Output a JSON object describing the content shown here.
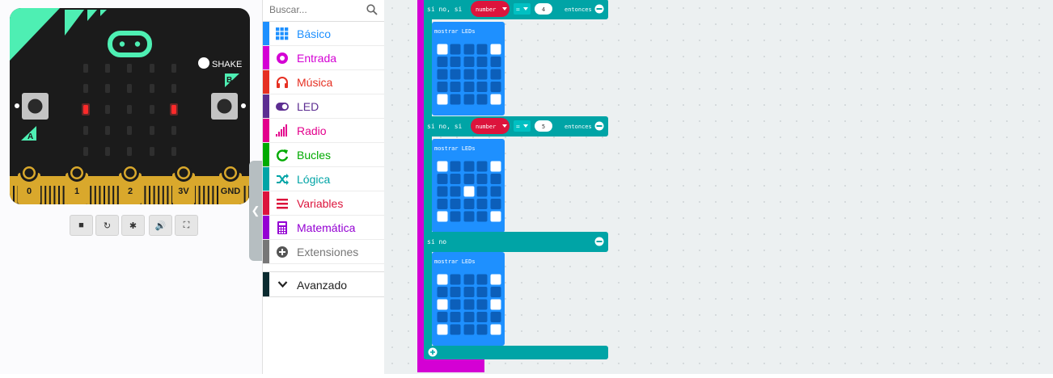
{
  "simulator": {
    "shake_label": "SHAKE",
    "button_a": "A",
    "button_b": "B",
    "pins": [
      "0",
      "1",
      "2",
      "3V",
      "GND"
    ],
    "controls": [
      {
        "name": "stop-button",
        "icon": "stop-icon"
      },
      {
        "name": "restart-button",
        "icon": "restart-icon"
      },
      {
        "name": "debug-button",
        "icon": "bug-icon"
      },
      {
        "name": "mute-button",
        "icon": "speaker-icon"
      },
      {
        "name": "fullscreen-button",
        "icon": "fullscreen-icon"
      }
    ],
    "led_matrix_on": [
      [
        0,
        0,
        0,
        0,
        0
      ],
      [
        0,
        0,
        0,
        0,
        0
      ],
      [
        1,
        0,
        0,
        0,
        1
      ],
      [
        0,
        0,
        0,
        0,
        0
      ],
      [
        0,
        0,
        0,
        0,
        0
      ]
    ]
  },
  "toolbox": {
    "search_placeholder": "Buscar...",
    "categories": [
      {
        "label": "Básico",
        "color": "#1e90ff",
        "icon": "grid-icon"
      },
      {
        "label": "Entrada",
        "color": "#d400d4",
        "icon": "target-icon"
      },
      {
        "label": "Música",
        "color": "#e63022",
        "icon": "headphones-icon"
      },
      {
        "label": "LED",
        "color": "#5c2d91",
        "icon": "toggle-icon"
      },
      {
        "label": "Radio",
        "color": "#e3008c",
        "icon": "signal-bars-icon"
      },
      {
        "label": "Bucles",
        "color": "#00aa00",
        "icon": "loop-icon"
      },
      {
        "label": "Lógica",
        "color": "#00a4a6",
        "icon": "shuffle-icon"
      },
      {
        "label": "Variables",
        "color": "#dc143c",
        "icon": "list-icon"
      },
      {
        "label": "Matemática",
        "color": "#9400d3",
        "icon": "calculator-icon"
      },
      {
        "label": "Extensiones",
        "color": "#777777",
        "icon": "plus-circle-icon"
      }
    ],
    "advanced": {
      "label": "Avanzado",
      "color": "#0b2b30",
      "icon": "chevron-down-icon"
    }
  },
  "workspace": {
    "blocks": [
      {
        "keyword": "si no, si",
        "variable": "number",
        "operator": "=",
        "value": "4",
        "then": "entonces",
        "body": "mostrar LEDs",
        "leds": [
          [
            1,
            0,
            0,
            0,
            1
          ],
          [
            0,
            0,
            0,
            0,
            0
          ],
          [
            0,
            0,
            0,
            0,
            0
          ],
          [
            0,
            0,
            0,
            0,
            0
          ],
          [
            1,
            0,
            0,
            0,
            1
          ]
        ]
      },
      {
        "keyword": "si no, si",
        "variable": "number",
        "operator": "=",
        "value": "5",
        "then": "entonces",
        "body": "mostrar LEDs",
        "leds": [
          [
            1,
            0,
            0,
            0,
            1
          ],
          [
            0,
            0,
            0,
            0,
            0
          ],
          [
            0,
            0,
            1,
            0,
            0
          ],
          [
            0,
            0,
            0,
            0,
            0
          ],
          [
            1,
            0,
            0,
            0,
            1
          ]
        ]
      },
      {
        "keyword": "si no",
        "body": "mostrar LEDs",
        "leds": [
          [
            1,
            0,
            0,
            0,
            1
          ],
          [
            0,
            0,
            0,
            0,
            0
          ],
          [
            1,
            0,
            0,
            0,
            1
          ],
          [
            0,
            0,
            0,
            0,
            0
          ],
          [
            1,
            0,
            0,
            0,
            1
          ]
        ]
      }
    ],
    "colors": {
      "logic": "#00a4a6",
      "basic": "#1e90ff",
      "event": "#d400d4",
      "variable": "#dc143c",
      "led_on": "#ffffff",
      "led_off": "#0c5fba"
    }
  }
}
